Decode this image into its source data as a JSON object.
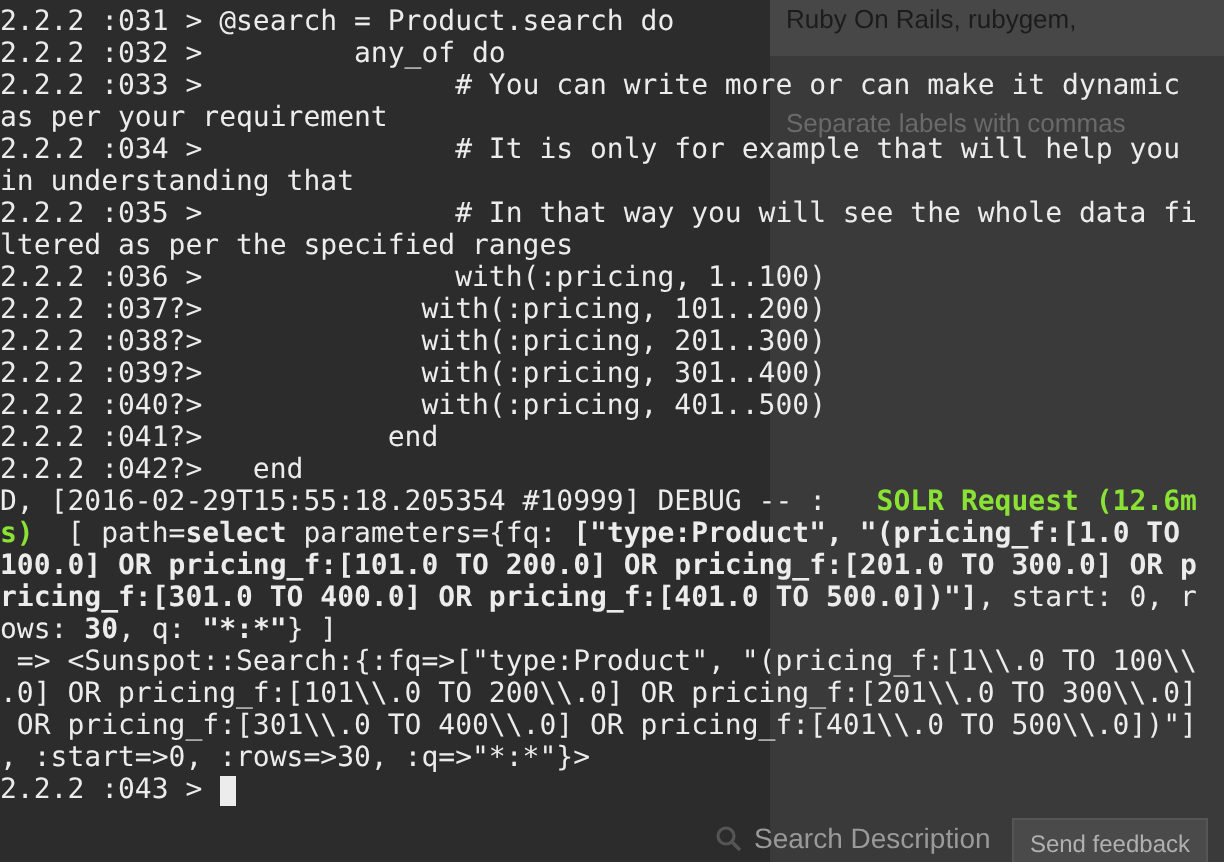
{
  "background_page": {
    "labels_value": "Ruby On Rails, rubygem,",
    "labels_hint": "Separate labels with commas",
    "search_description": "Search Description",
    "feedback_button": "Send feedback"
  },
  "terminal": {
    "cursor": true,
    "lines": [
      {
        "segments": [
          {
            "kind": "plain",
            "text": "2.2.2 :031 > @search = Product.search do"
          }
        ]
      },
      {
        "segments": [
          {
            "kind": "plain",
            "text": "2.2.2 :032 >         any_of do"
          }
        ]
      },
      {
        "segments": [
          {
            "kind": "plain",
            "text": "2.2.2 :033 >               # You can write more or can make it dynamic"
          }
        ]
      },
      {
        "segments": [
          {
            "kind": "plain",
            "text": "as per your requirement"
          }
        ]
      },
      {
        "segments": [
          {
            "kind": "plain",
            "text": "2.2.2 :034 >               # It is only for example that will help you"
          }
        ]
      },
      {
        "segments": [
          {
            "kind": "plain",
            "text": "in understanding that"
          }
        ]
      },
      {
        "segments": [
          {
            "kind": "plain",
            "text": "2.2.2 :035 >               # In that way you will see the whole data fi"
          }
        ]
      },
      {
        "segments": [
          {
            "kind": "plain",
            "text": "ltered as per the specified ranges"
          }
        ]
      },
      {
        "segments": [
          {
            "kind": "plain",
            "text": "2.2.2 :036 >               with(:pricing, 1..100)"
          }
        ]
      },
      {
        "segments": [
          {
            "kind": "plain",
            "text": "2.2.2 :037?>             with(:pricing, 101..200)"
          }
        ]
      },
      {
        "segments": [
          {
            "kind": "plain",
            "text": "2.2.2 :038?>             with(:pricing, 201..300)"
          }
        ]
      },
      {
        "segments": [
          {
            "kind": "plain",
            "text": "2.2.2 :039?>             with(:pricing, 301..400)"
          }
        ]
      },
      {
        "segments": [
          {
            "kind": "plain",
            "text": "2.2.2 :040?>             with(:pricing, 401..500)"
          }
        ]
      },
      {
        "segments": [
          {
            "kind": "plain",
            "text": "2.2.2 :041?>           end"
          }
        ]
      },
      {
        "segments": [
          {
            "kind": "plain",
            "text": "2.2.2 :042?>   end"
          }
        ]
      },
      {
        "segments": [
          {
            "kind": "plain",
            "text": "D, [2016-02-29T15:55:18.205354 #10999] DEBUG -- :   "
          },
          {
            "kind": "green",
            "text": "SOLR Request (12.6m"
          }
        ]
      },
      {
        "segments": [
          {
            "kind": "green",
            "text": "s)"
          },
          {
            "kind": "plain",
            "text": "  [ path="
          },
          {
            "kind": "bold",
            "text": "select"
          },
          {
            "kind": "plain",
            "text": " parameters={fq: "
          },
          {
            "kind": "bold",
            "text": "[\"type:Product\", \"(pricing_f:[1.0 TO"
          }
        ]
      },
      {
        "segments": [
          {
            "kind": "bold",
            "text": "100.0] OR pricing_f:[101.0 TO 200.0] OR pricing_f:[201.0 TO 300.0] OR p"
          }
        ]
      },
      {
        "segments": [
          {
            "kind": "bold",
            "text": "ricing_f:[301.0 TO 400.0] OR pricing_f:[401.0 TO 500.0])\"]"
          },
          {
            "kind": "plain",
            "text": ", start: 0, r"
          }
        ]
      },
      {
        "segments": [
          {
            "kind": "plain",
            "text": "ows: "
          },
          {
            "kind": "bold",
            "text": "30"
          },
          {
            "kind": "plain",
            "text": ", q: "
          },
          {
            "kind": "bold",
            "text": "\"*:*\""
          },
          {
            "kind": "plain",
            "text": "} ]"
          }
        ]
      },
      {
        "segments": [
          {
            "kind": "plain",
            "text": " => <Sunspot::Search:{:fq=>[\"type:Product\", \"(pricing_f:[1\\\\.0 TO 100\\\\"
          }
        ]
      },
      {
        "segments": [
          {
            "kind": "plain",
            "text": ".0] OR pricing_f:[101\\\\.0 TO 200\\\\.0] OR pricing_f:[201\\\\.0 TO 300\\\\.0]"
          }
        ]
      },
      {
        "segments": [
          {
            "kind": "plain",
            "text": " OR pricing_f:[301\\\\.0 TO 400\\\\.0] OR pricing_f:[401\\\\.0 TO 500\\\\.0])\"]"
          }
        ]
      },
      {
        "segments": [
          {
            "kind": "plain",
            "text": ", :start=>0, :rows=>30, :q=>\"*:*\"}>"
          }
        ]
      },
      {
        "segments": [
          {
            "kind": "plain",
            "text": "2.2.2 :043 > "
          }
        ]
      }
    ]
  }
}
